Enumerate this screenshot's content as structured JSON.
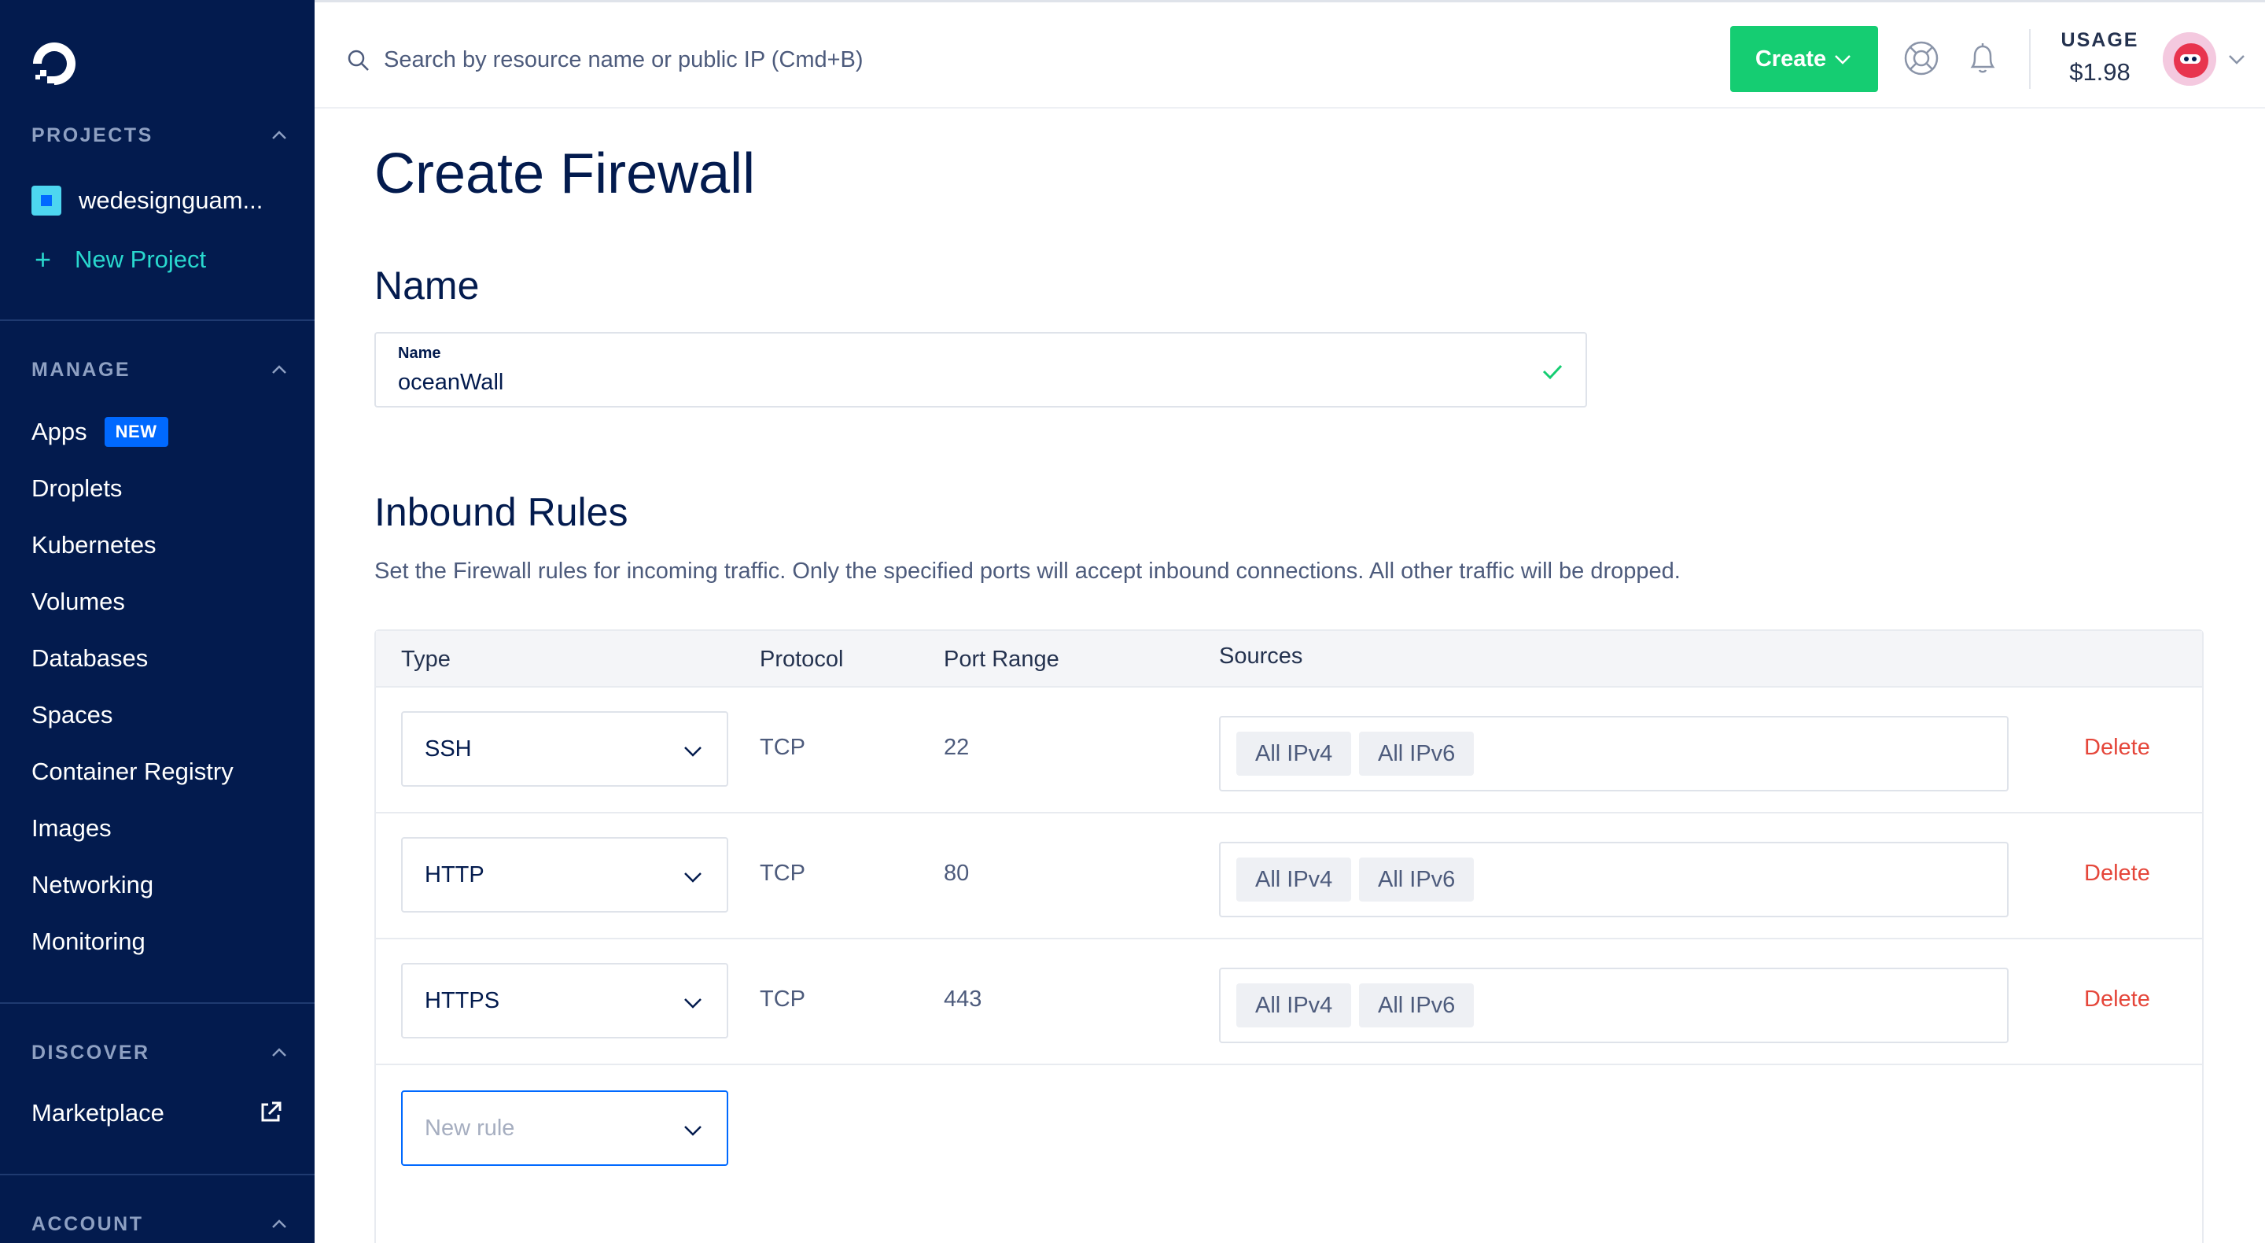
{
  "sidebar": {
    "projects_title": "PROJECTS",
    "project_name": "wedesignguam...",
    "new_project": "New Project",
    "manage_title": "MANAGE",
    "apps_label": "Apps",
    "apps_badge": "NEW",
    "items": [
      "Droplets",
      "Kubernetes",
      "Volumes",
      "Databases",
      "Spaces",
      "Container Registry",
      "Images",
      "Networking",
      "Monitoring"
    ],
    "discover_title": "DISCOVER",
    "marketplace": "Marketplace",
    "account_title": "ACCOUNT"
  },
  "topbar": {
    "search_placeholder": "Search by resource name or public IP (Cmd+B)",
    "create_label": "Create",
    "usage_label": "USAGE",
    "usage_value": "$1.98"
  },
  "main": {
    "title": "Create Firewall",
    "name_heading": "Name",
    "name_field_label": "Name",
    "name_value": "oceanWall",
    "inbound_heading": "Inbound Rules",
    "inbound_desc": "Set the Firewall rules for incoming traffic. Only the specified ports will accept inbound connections. All other traffic will be dropped.",
    "columns": [
      "Type",
      "Protocol",
      "Port Range",
      "Sources"
    ],
    "rules": [
      {
        "type": "SSH",
        "protocol": "TCP",
        "port": "22",
        "sources": [
          "All IPv4",
          "All IPv6"
        ],
        "action": "Delete"
      },
      {
        "type": "HTTP",
        "protocol": "TCP",
        "port": "80",
        "sources": [
          "All IPv4",
          "All IPv6"
        ],
        "action": "Delete"
      },
      {
        "type": "HTTPS",
        "protocol": "TCP",
        "port": "443",
        "sources": [
          "All IPv4",
          "All IPv6"
        ],
        "action": "Delete"
      }
    ],
    "new_rule_placeholder": "New rule"
  },
  "colors": {
    "sidebar_bg": "#031b4e",
    "create_green": "#15cd72",
    "accent_blue": "#0069ff",
    "delete_red": "#e5463a",
    "teal": "#29d8ce"
  }
}
